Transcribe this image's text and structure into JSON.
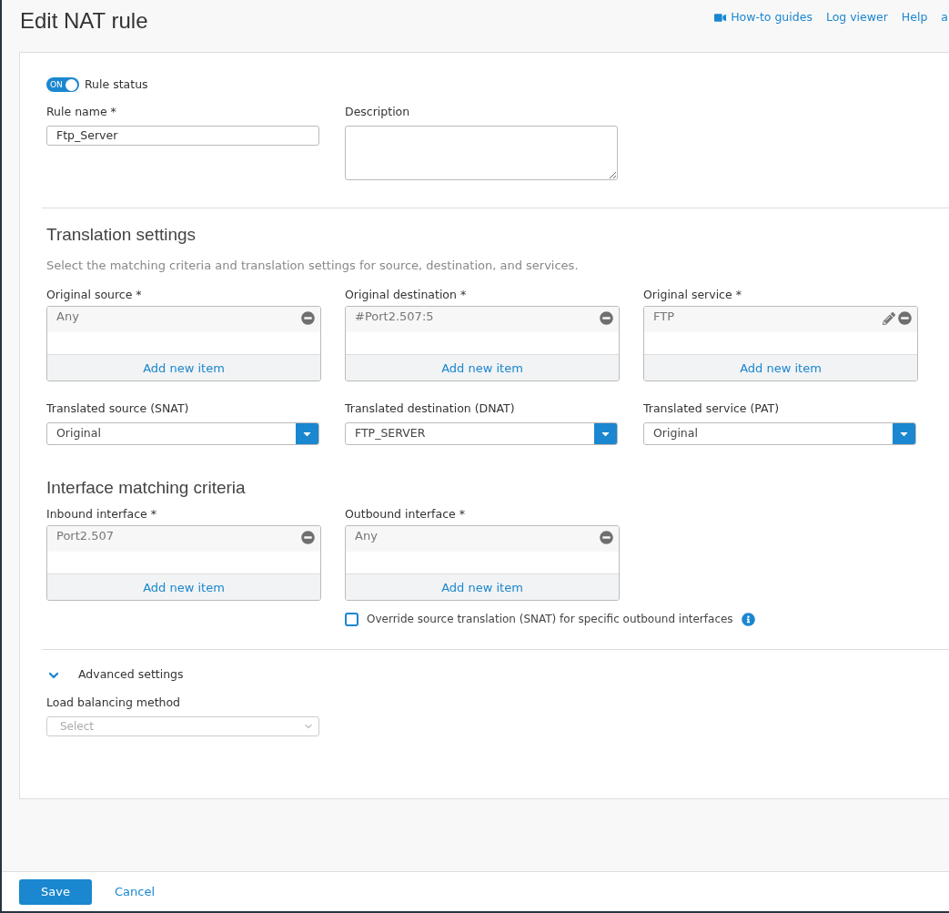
{
  "header": {
    "title": "Edit NAT rule",
    "links": [
      {
        "label": "How-to guides",
        "kind": "video"
      },
      {
        "label": "Log viewer",
        "kind": "plain"
      },
      {
        "label": "Help",
        "kind": "plain"
      },
      {
        "label": "a",
        "kind": "plain"
      }
    ]
  },
  "rule_status": {
    "label": "Rule status",
    "on": true,
    "toggle_text": "ON"
  },
  "rule_name": {
    "label": "Rule name *",
    "value": "Ftp_Server"
  },
  "description": {
    "label": "Description"
  },
  "translation": {
    "title": "Translation settings",
    "subtitle": "Select the matching criteria and translation settings for source, destination, and services.",
    "lists": [
      {
        "label": "Original source *",
        "items": [
          {
            "text": "Any",
            "editable": false
          }
        ],
        "add": "Add new item"
      },
      {
        "label": "Original destination *",
        "items": [
          {
            "text": "#Port2.507:5",
            "editable": false
          }
        ],
        "add": "Add new item"
      },
      {
        "label": "Original service *",
        "items": [
          {
            "text": "FTP",
            "editable": true
          }
        ],
        "add": "Add new item"
      }
    ],
    "dropdowns": [
      {
        "label": "Translated source (SNAT)",
        "value": "Original"
      },
      {
        "label": "Translated destination (DNAT)",
        "value": "FTP_SERVER"
      },
      {
        "label": "Translated service (PAT)",
        "value": "Original"
      }
    ]
  },
  "interface": {
    "title": "Interface matching criteria",
    "lists": [
      {
        "label": "Inbound interface *",
        "items": [
          {
            "text": "Port2.507",
            "editable": false
          }
        ],
        "add": "Add new item"
      },
      {
        "label": "Outbound interface *",
        "items": [
          {
            "text": "Any",
            "editable": false
          }
        ],
        "add": "Add new item"
      }
    ],
    "override": {
      "label": "Override source translation (SNAT) for specific outbound interfaces",
      "checked": false
    }
  },
  "advanced": {
    "label": "Advanced settings",
    "expanded": true,
    "load_balancing": {
      "label": "Load balancing method",
      "placeholder": "Select"
    }
  },
  "footer": {
    "save": "Save",
    "cancel": "Cancel"
  }
}
